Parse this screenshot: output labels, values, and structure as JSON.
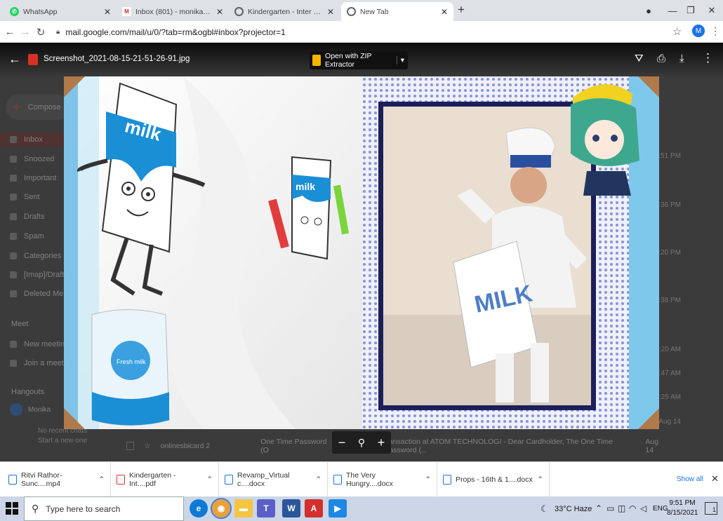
{
  "tabs": [
    {
      "title": "WhatsApp",
      "icon": "whatsapp-icon",
      "color": "#25d366"
    },
    {
      "title": "Inbox (801) - monikasarna83@g",
      "icon": "gmail-icon",
      "color": "#d93025"
    },
    {
      "title": "Kindergarten - Inter School Event",
      "icon": "chrome-icon",
      "color": "#5f6368"
    },
    {
      "title": "New Tab",
      "icon": "chrome-icon",
      "color": "#5f6368"
    }
  ],
  "address": {
    "url": "mail.google.com/mail/u/0/?tab=rm&ogbl#inbox?projector=1",
    "profile_initial": "M"
  },
  "viewer": {
    "filename": "Screenshot_2021-08-15-21-51-26-91.jpg",
    "open_with": "Open with ZIP Extractor"
  },
  "gmail_bg": {
    "compose": "Compose",
    "folders": [
      "Inbox",
      "Snoozed",
      "Important",
      "Sent",
      "Drafts",
      "Spam",
      "Categories",
      "[Imap]/Drafts",
      "Deleted Me"
    ],
    "meet_header": "Meet",
    "meet_items": [
      "New meeting",
      "Join a meeting"
    ],
    "hangouts_header": "Hangouts",
    "hangouts_user": "Monika",
    "times": [
      "9:51 PM",
      "8:36 PM",
      "6:20 PM",
      "2:38 PM",
      "7:20 AM",
      "6:47 AM",
      "2:25 AM",
      "Aug 14",
      "Aug 14"
    ],
    "mail_row": {
      "sender": "onlinesbicard 2",
      "subject": "One Time Password (O",
      "snippet": "transaction at ATOM TECHNOLOGI - Dear Cardholder, The One Time Password (...",
      "date": "Aug 14"
    },
    "no_recent": "No recent chats",
    "start_new": "Start a new one"
  },
  "photo": {
    "carton_big": "milk",
    "carton_small": "milk",
    "costume_label": "MILK",
    "pack_label": "Fresh milk"
  },
  "zoom": {
    "minus": "−",
    "zoom_icon": "zoom-icon",
    "plus": "+"
  },
  "downloads": [
    {
      "name": "Ritvi Rathor-Sunc....mp4",
      "color": "#1a73e8"
    },
    {
      "name": "Kindergarten - Int....pdf",
      "color": "#d93025"
    },
    {
      "name": "Revamp_Virtual c....docx",
      "color": "#1a73e8"
    },
    {
      "name": "The Very Hungry....docx",
      "color": "#1a73e8"
    },
    {
      "name": "Props - 16th & 1....docx",
      "color": "#1a73e8"
    }
  ],
  "downloads_show_all": "Show all",
  "taskbar": {
    "search_placeholder": "Type here to search",
    "weather": "33°C  Haze",
    "lang": "ENG",
    "time": "9:51 PM",
    "date": "8/15/2021",
    "notif_count": "1"
  }
}
